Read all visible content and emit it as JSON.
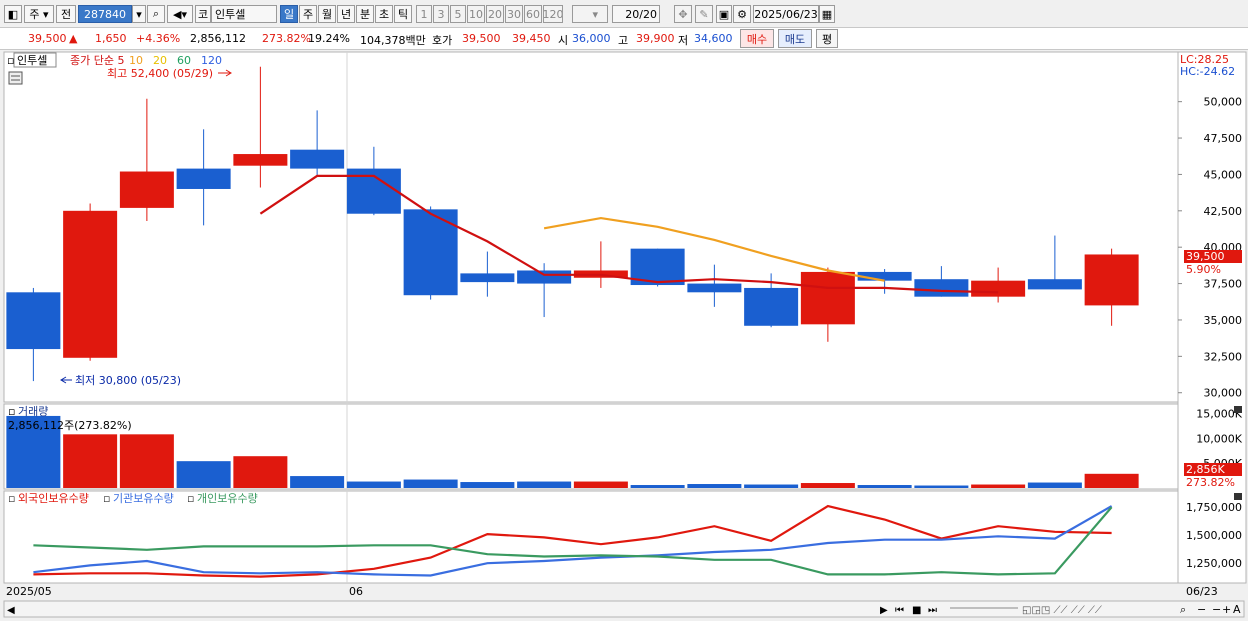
{
  "toolbar": {
    "type_label": "주",
    "prev_label": "전",
    "code": "287840",
    "stock_type": "코",
    "stock_name": "인투셀",
    "periods": [
      {
        "label": "일",
        "active": true
      },
      {
        "label": "주",
        "active": false
      },
      {
        "label": "월",
        "active": false
      },
      {
        "label": "년",
        "active": false
      },
      {
        "label": "분",
        "active": false
      },
      {
        "label": "초",
        "active": false
      },
      {
        "label": "틱",
        "active": false
      }
    ],
    "intervals": [
      "1",
      "3",
      "5",
      "10",
      "20",
      "30",
      "60",
      "120"
    ],
    "count": "20",
    "count_total": "/20",
    "date": "2025/06/23"
  },
  "info": {
    "price": "39,500",
    "arrow": "▲",
    "change": "1,650",
    "change_pct": "+4.36%",
    "volume": "2,856,112",
    "vol_ratio": "273.82%",
    "turnover": "19.24%",
    "amount": "104,378백만",
    "quote_label": "호가",
    "ask": "39,500",
    "bid": "39,450",
    "open_label": "시",
    "open": "36,000",
    "high_label": "고",
    "high": "39,900",
    "low_label": "저",
    "low": "34,600",
    "buy_label": "매수",
    "sell_label": "매도",
    "flat_label": "평"
  },
  "colors": {
    "up": "#e0180e",
    "down": "#1a5fd0",
    "ma5": "#d01010",
    "ma10": "#f0a020",
    "foreign": "#e0180e",
    "inst": "#3a6ee0",
    "indiv": "#3a9a60"
  },
  "price_panel": {
    "title": "인투셀",
    "legend": [
      {
        "text": "종가 단순 5",
        "color": "#d01010"
      },
      {
        "text": "10",
        "color": "#f0a020"
      },
      {
        "text": "20",
        "color": "#e8c000"
      },
      {
        "text": "60",
        "color": "#20a060"
      },
      {
        "text": "120",
        "color": "#3060e0"
      }
    ],
    "high_note": "최고 52,400 (05/29)",
    "low_note": "최저 30,800 (05/23)",
    "lc": "LC:28.25",
    "hc": "HC:-24.62",
    "cur_label": "39,500",
    "cur_pct": "5.90%",
    "ticks": [
      "50,000",
      "47,500",
      "45,000",
      "42,500",
      "40,000",
      "37,500",
      "35,000",
      "32,500",
      "30,000"
    ]
  },
  "vol_panel": {
    "title": "거래량",
    "note": "2,856,112주(273.82%)",
    "ticks": [
      "15,000K",
      "10,000K",
      "5,000K"
    ],
    "cur_label": "2,856K",
    "cur_pct": "273.82%"
  },
  "hold_panel": {
    "legend": [
      {
        "text": "외국인보유수량",
        "color": "#e0180e"
      },
      {
        "text": "기관보유수량",
        "color": "#3a6ee0"
      },
      {
        "text": "개인보유수량",
        "color": "#3a9a60"
      }
    ],
    "ticks": [
      "1,750,000",
      "1,500,000",
      "1,250,000"
    ]
  },
  "xaxis": {
    "start": "2025/05",
    "mid": "06",
    "end": "06/23"
  },
  "chart_data": [
    {
      "type": "candlestick",
      "title": "인투셀",
      "y_range": [
        29500,
        53000
      ],
      "candles": [
        {
          "o": 36900,
          "h": 37200,
          "l": 30800,
          "c": 33000
        },
        {
          "o": 32400,
          "h": 43000,
          "l": 32200,
          "c": 42500
        },
        {
          "o": 42700,
          "h": 50200,
          "l": 41800,
          "c": 45200
        },
        {
          "o": 45400,
          "h": 48100,
          "l": 41500,
          "c": 44000
        },
        {
          "o": 45600,
          "h": 52400,
          "l": 44100,
          "c": 46400
        },
        {
          "o": 46700,
          "h": 49400,
          "l": 44900,
          "c": 45400
        },
        {
          "o": 45400,
          "h": 46900,
          "l": 42200,
          "c": 42300
        },
        {
          "o": 42600,
          "h": 42800,
          "l": 36400,
          "c": 36700
        },
        {
          "o": 38200,
          "h": 39700,
          "l": 36600,
          "c": 37600
        },
        {
          "o": 38400,
          "h": 38900,
          "l": 35200,
          "c": 37500
        },
        {
          "o": 37900,
          "h": 40400,
          "l": 37200,
          "c": 38400
        },
        {
          "o": 39900,
          "h": 39900,
          "l": 37300,
          "c": 37400
        },
        {
          "o": 37500,
          "h": 38800,
          "l": 35900,
          "c": 36900
        },
        {
          "o": 37200,
          "h": 38200,
          "l": 34500,
          "c": 34600
        },
        {
          "o": 34700,
          "h": 38600,
          "l": 33500,
          "c": 38300
        },
        {
          "o": 38300,
          "h": 38500,
          "l": 36800,
          "c": 37700
        },
        {
          "o": 37800,
          "h": 38700,
          "l": 36600,
          "c": 36600
        },
        {
          "o": 36600,
          "h": 38600,
          "l": 36200,
          "c": 37700
        },
        {
          "o": 37800,
          "h": 40800,
          "l": 37200,
          "c": 37100
        },
        {
          "o": 36000,
          "h": 39900,
          "l": 34600,
          "c": 39500
        }
      ],
      "ma5": [
        null,
        null,
        null,
        null,
        42300,
        44900,
        44900,
        42300,
        40400,
        38100,
        38100,
        37600,
        37800,
        37600,
        37200,
        37200,
        37000,
        36900,
        null,
        null
      ],
      "ma10": [
        null,
        null,
        null,
        null,
        null,
        null,
        null,
        null,
        null,
        41300,
        42000,
        41400,
        40500,
        39400,
        38400,
        37700,
        null,
        null,
        null,
        null
      ]
    },
    {
      "type": "bar",
      "title": "거래량",
      "unit": "K",
      "values": [
        14500,
        10800,
        10800,
        5400,
        6400,
        2400,
        1300,
        1700,
        1200,
        1300,
        1300,
        600,
        800,
        700,
        1000,
        600,
        500,
        700,
        1100,
        2856
      ]
    },
    {
      "type": "line",
      "series": [
        {
          "name": "외국인보유수량",
          "values": [
            1150000,
            1160000,
            1160000,
            1140000,
            1130000,
            1150000,
            1200000,
            1300000,
            1510000,
            1480000,
            1420000,
            1480000,
            1580000,
            1450000,
            1760000,
            1640000,
            1470000,
            1580000,
            1530000,
            1520000
          ]
        },
        {
          "name": "기관보유수량",
          "values": [
            1170000,
            1230000,
            1270000,
            1170000,
            1160000,
            1170000,
            1150000,
            1140000,
            1250000,
            1270000,
            1300000,
            1320000,
            1350000,
            1370000,
            1430000,
            1460000,
            1460000,
            1490000,
            1470000,
            1760000
          ]
        },
        {
          "name": "개인보유수량",
          "values": [
            1410000,
            1390000,
            1370000,
            1400000,
            1400000,
            1400000,
            1410000,
            1410000,
            1330000,
            1310000,
            1320000,
            1310000,
            1280000,
            1280000,
            1150000,
            1150000,
            1170000,
            1150000,
            1160000,
            1750000
          ]
        }
      ],
      "y_range": [
        1100000,
        1850000
      ]
    }
  ]
}
